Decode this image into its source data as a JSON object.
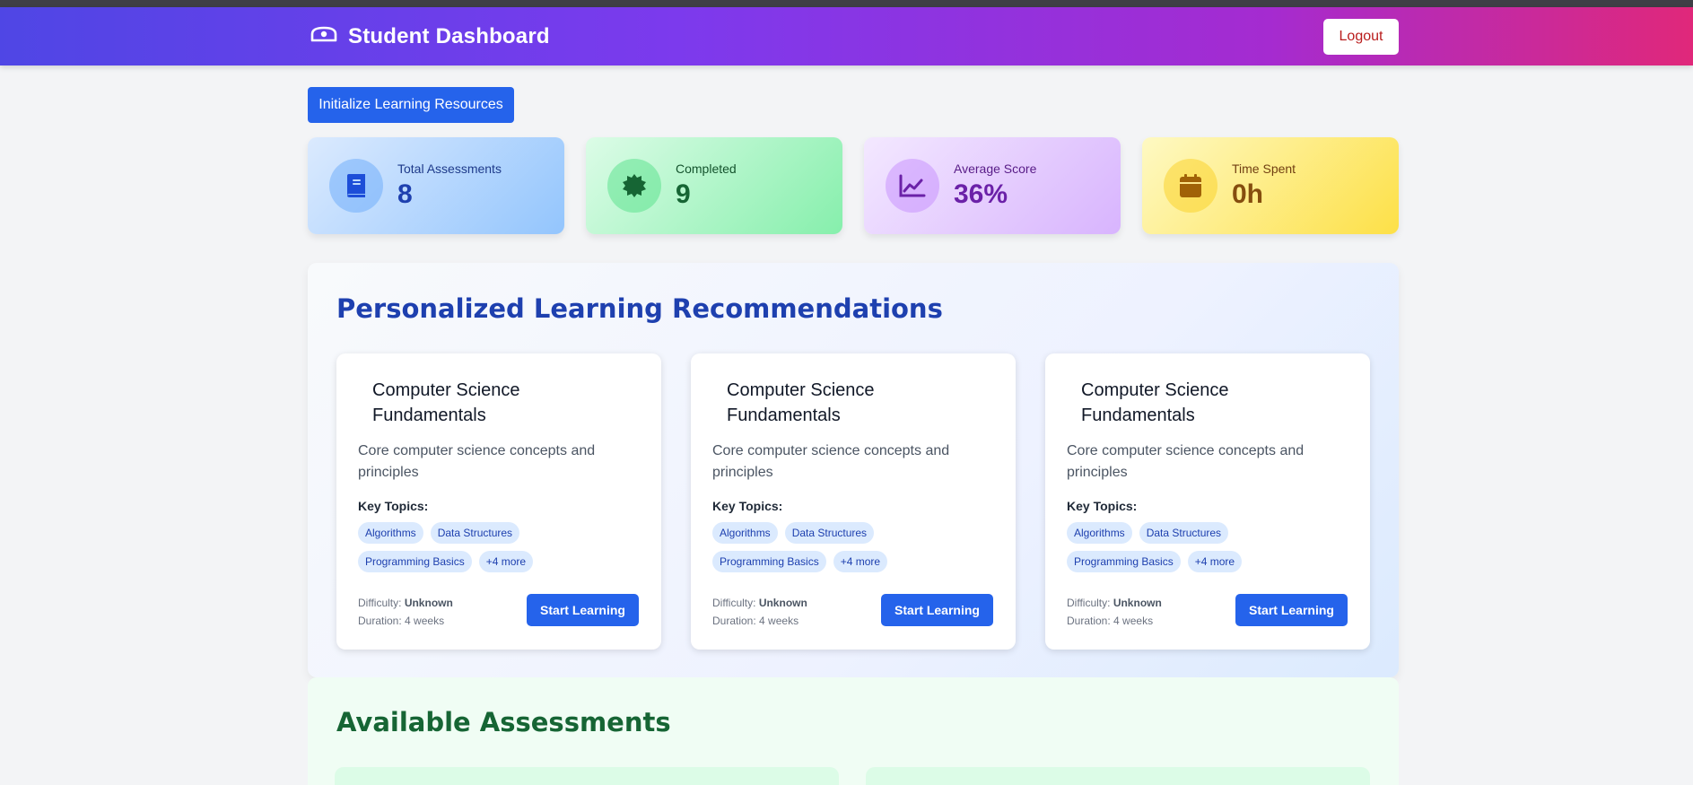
{
  "header": {
    "title": "Student Dashboard",
    "logout_label": "Logout",
    "logo_icon": "graduation-cap-icon"
  },
  "actions": {
    "init_label": "Initialize Learning Resources"
  },
  "stats": [
    {
      "label": "Total Assessments",
      "value": "8",
      "icon": "book-icon"
    },
    {
      "label": "Completed",
      "value": "9",
      "icon": "badge-check-icon"
    },
    {
      "label": "Average Score",
      "value": "36%",
      "icon": "chart-line-icon"
    },
    {
      "label": "Time Spent",
      "value": "0h",
      "icon": "calendar-icon"
    }
  ],
  "recommendations": {
    "title": "Personalized Learning Recommendations",
    "cards": [
      {
        "title": "Computer Science Fundamentals",
        "description": "Core computer science concepts and principles",
        "topics_label": "Key Topics:",
        "tags": [
          "Algorithms",
          "Data Structures",
          "Programming Basics",
          "+4 more"
        ],
        "difficulty_label": "Difficulty:",
        "difficulty": "Unknown",
        "duration_label": "Duration:",
        "duration": "4 weeks",
        "button_label": "Start Learning"
      },
      {
        "title": "Computer Science Fundamentals",
        "description": "Core computer science concepts and principles",
        "topics_label": "Key Topics:",
        "tags": [
          "Algorithms",
          "Data Structures",
          "Programming Basics",
          "+4 more"
        ],
        "difficulty_label": "Difficulty:",
        "difficulty": "Unknown",
        "duration_label": "Duration:",
        "duration": "4 weeks",
        "button_label": "Start Learning"
      },
      {
        "title": "Computer Science Fundamentals",
        "description": "Core computer science concepts and principles",
        "topics_label": "Key Topics:",
        "tags": [
          "Algorithms",
          "Data Structures",
          "Programming Basics",
          "+4 more"
        ],
        "difficulty_label": "Difficulty:",
        "difficulty": "Unknown",
        "duration_label": "Duration:",
        "duration": "4 weeks",
        "button_label": "Start Learning"
      }
    ]
  },
  "assessments": {
    "title": "Available Assessments"
  },
  "colors": {
    "primary": "#2563eb",
    "header_start": "#4f46e5",
    "header_end": "#e0287a",
    "logout_text": "#b91c1c"
  }
}
